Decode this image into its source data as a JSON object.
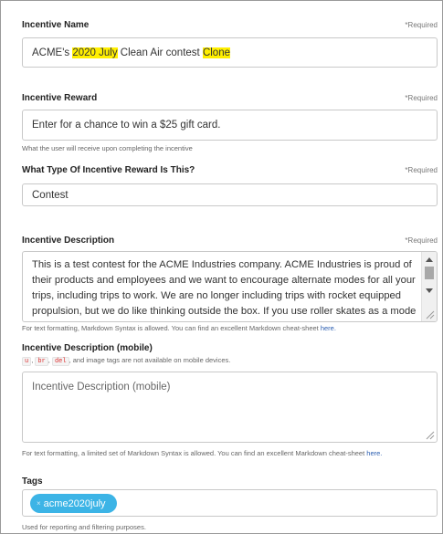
{
  "incentive_name": {
    "label": "Incentive Name",
    "required": "*Required",
    "value_parts": [
      "ACME's ",
      "2020 July",
      " Clean Air contest ",
      "Clone"
    ]
  },
  "incentive_reward": {
    "label": "Incentive Reward",
    "required": "*Required",
    "value": "Enter for a chance to win a $25 gift card.",
    "help": "What the user will receive upon completing the incentive"
  },
  "reward_type": {
    "label": "What Type Of Incentive Reward Is This?",
    "required": "*Required",
    "value": "Contest"
  },
  "incentive_description": {
    "label": "Incentive Description",
    "required": "*Required",
    "value": "This is a test contest for the ACME Industries company. ACME Industries is proud of their products and employees and we want to encourage alternate modes for all your trips, including trips to work. We are no longer including trips with rocket equipped propulsion, but we do like thinking outside the box. If you use roller skates as a mode then please select walk as this computer site refuses to add roller skates as a mode for us. It seems only our",
    "help_prefix": "For text formatting, Markdown Syntax is allowed. You can find an excellent Markdown cheat-sheet ",
    "help_link": "here."
  },
  "incentive_description_mobile": {
    "label": "Incentive Description (mobile)",
    "code_tags": [
      "u",
      "br",
      "del"
    ],
    "note": ", and image tags are not available on mobile devices.",
    "placeholder": "Incentive Description (mobile)",
    "help_prefix": "For text formatting, a limited set of Markdown Syntax is allowed. You can find an excellent Markdown cheat-sheet ",
    "help_link": "here."
  },
  "tags": {
    "label": "Tags",
    "items": [
      "acme2020july"
    ],
    "remove_glyph": "×",
    "help": "Used for reporting and filtering purposes."
  },
  "colors": {
    "highlight": "#ffef00",
    "tag_background": "#3cb4e6",
    "link": "#2a5db0"
  }
}
